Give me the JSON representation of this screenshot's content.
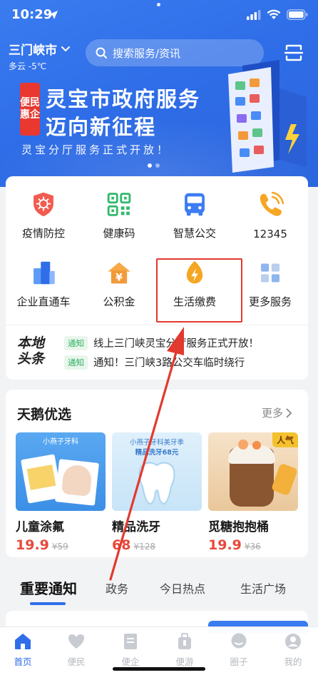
{
  "colors": {
    "brand_blue": "#2f6ee8",
    "annotation_red": "#e23a2e",
    "price_red": "#e8483b",
    "notice_green": "#2db05f"
  },
  "status_bar": {
    "time": "10:29"
  },
  "header": {
    "city": "三门峡市",
    "weather": "多云 -5℃",
    "search_placeholder": "搜索服务/资讯"
  },
  "banner": {
    "tag_line1": "便民",
    "tag_line2": "惠企",
    "title_line1": "灵宝市政府服务",
    "title_line2": "迈向新征程",
    "subtitle": "灵宝分厅服务正式开放！"
  },
  "services": [
    {
      "label": "疫情防控",
      "icon": "shield-virus-icon"
    },
    {
      "label": "健康码",
      "icon": "qr-code-icon"
    },
    {
      "label": "智慧公交",
      "icon": "bus-icon"
    },
    {
      "label": "12345",
      "icon": "phone-icon"
    },
    {
      "label": "企业直通车",
      "icon": "buildings-icon"
    },
    {
      "label": "公积金",
      "icon": "house-fund-icon"
    },
    {
      "label": "生活缴费",
      "icon": "flame-bill-icon"
    },
    {
      "label": "更多服务",
      "icon": "grid-more-icon"
    }
  ],
  "news": {
    "logo_line1": "本地",
    "logo_line2": "头条",
    "items": [
      {
        "tag": "通知",
        "text": "线上三门峡灵宝分厅服务正式开放！"
      },
      {
        "tag": "通知",
        "text": "通知！三门峡3路公交车临时绕行"
      }
    ]
  },
  "shop": {
    "title": "天鹅优选",
    "more": "更多",
    "products": [
      {
        "name": "儿童涂氟",
        "price": "19.9",
        "old_price": "¥59",
        "img_caption": "小燕子牙科"
      },
      {
        "name": "精品洗牙",
        "price": "68",
        "old_price": "¥128",
        "img_caption": "小燕子牙科美牙季",
        "img_caption2": "精品洗牙68元"
      },
      {
        "name": "觅糖抱抱桶",
        "price": "19.9",
        "old_price": "¥36",
        "badge": "人气"
      }
    ]
  },
  "tabs": [
    "重要通知",
    "政务",
    "今日热点",
    "生活广场"
  ],
  "bottom_nav": [
    {
      "label": "首页",
      "icon": "home-icon",
      "active": true
    },
    {
      "label": "便民",
      "icon": "heart-icon",
      "active": false
    },
    {
      "label": "便企",
      "icon": "document-icon",
      "active": false
    },
    {
      "label": "便游",
      "icon": "suitcase-icon",
      "active": false
    },
    {
      "label": "圈子",
      "icon": "chat-icon",
      "active": false
    },
    {
      "label": "我的",
      "icon": "user-icon",
      "active": false
    }
  ]
}
